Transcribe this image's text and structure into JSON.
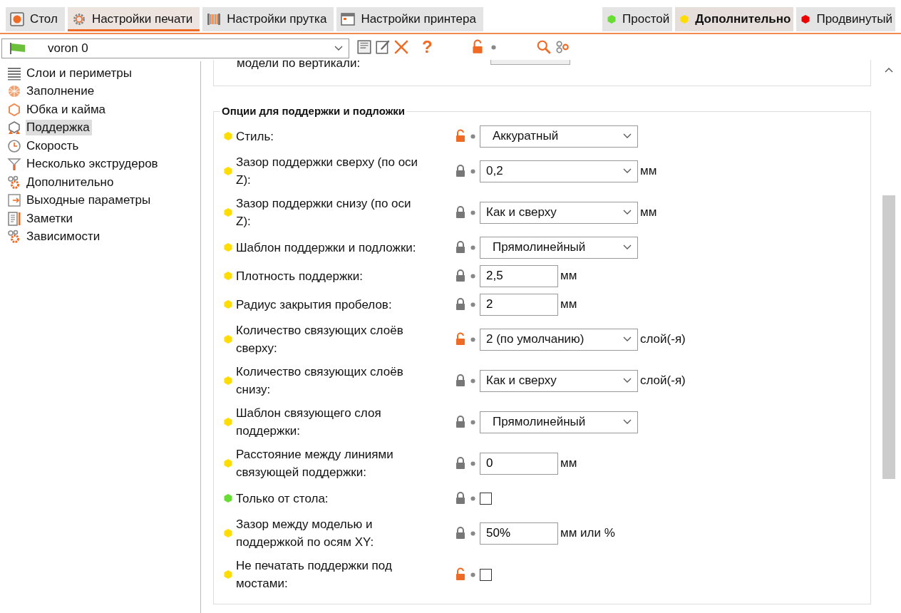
{
  "tabs": [
    {
      "label": "Стол",
      "selected": false
    },
    {
      "label": "Настройки печати",
      "selected": true
    },
    {
      "label": "Настройки прутка",
      "selected": false
    },
    {
      "label": "Настройки принтера",
      "selected": false
    }
  ],
  "modes": [
    {
      "label": "Простой",
      "color": "#66dd33",
      "selected": false
    },
    {
      "label": "Дополнительно",
      "color": "#ffdd00",
      "selected": true
    },
    {
      "label": "Продвинутый",
      "color": "#ee0000",
      "selected": false
    }
  ],
  "preset": {
    "value": "voron 0"
  },
  "toolbar": {
    "help": "?",
    "locked": false
  },
  "sidebar": {
    "items": [
      {
        "label": "Слои и периметры",
        "selected": false
      },
      {
        "label": "Заполнение",
        "selected": false
      },
      {
        "label": "Юбка и кайма",
        "selected": false
      },
      {
        "label": "Поддержка",
        "selected": true
      },
      {
        "label": "Скорость",
        "selected": false
      },
      {
        "label": "Несколько экструдеров",
        "selected": false
      },
      {
        "label": "Дополнительно",
        "selected": false
      },
      {
        "label": "Выходные параметры",
        "selected": false
      },
      {
        "label": "Заметки",
        "selected": false
      },
      {
        "label": "Зависимости",
        "selected": false
      }
    ]
  },
  "prev_section": {
    "label": "модели по вертикали:"
  },
  "section": {
    "title": "Опции для поддержки и подложки",
    "rows": [
      {
        "label": "Стиль:",
        "color": "#ffdd00",
        "locked": false,
        "kind": "combo",
        "value": "Аккуратный",
        "indent": true
      },
      {
        "label": "Зазор поддержки сверху (по оси Z):",
        "color": "#ffdd00",
        "locked": true,
        "kind": "combo",
        "value": "0,2",
        "unit": "мм",
        "indent": false
      },
      {
        "label": "Зазор поддержки снизу (по оси Z):",
        "color": "#ffdd00",
        "locked": true,
        "kind": "combo",
        "value": "Как и сверху",
        "unit": "мм",
        "indent": false
      },
      {
        "label": "Шаблон поддержки и подложки:",
        "color": "#ffdd00",
        "locked": true,
        "kind": "combo",
        "value": "Прямолинейный",
        "indent": true
      },
      {
        "label": "Плотность поддержки:",
        "color": "#ffdd00",
        "locked": true,
        "kind": "input",
        "value": "2,5",
        "unit": "мм"
      },
      {
        "label": "Радиус закрытия пробелов:",
        "color": "#ffdd00",
        "locked": true,
        "kind": "input",
        "value": "2",
        "unit": "мм"
      },
      {
        "label": "Количество связующих слоёв сверху:",
        "color": "#ffdd00",
        "locked": false,
        "kind": "combo",
        "value": "2 (по умолчанию)",
        "unit": "слой(-я)",
        "indent": false
      },
      {
        "label": "Количество связующих слоёв снизу:",
        "color": "#ffdd00",
        "locked": true,
        "kind": "combo",
        "value": "Как и сверху",
        "unit": "слой(-я)",
        "indent": false
      },
      {
        "label": "Шаблон связующего слоя поддержки:",
        "color": "#ffdd00",
        "locked": true,
        "kind": "combo",
        "value": "Прямолинейный",
        "indent": true
      },
      {
        "label": "Расстояние между линиями связующей поддержки:",
        "color": "#ffdd00",
        "locked": true,
        "kind": "input",
        "value": "0",
        "unit": "мм"
      },
      {
        "label": "Только от стола:",
        "color": "#66dd33",
        "locked": true,
        "kind": "checkbox",
        "checked": false
      },
      {
        "label": "Зазор между моделью и поддержкой по осям XY:",
        "color": "#ffdd00",
        "locked": true,
        "kind": "input",
        "value": "50%",
        "unit": "мм или %"
      },
      {
        "label": "Не печатать поддержки под мостами:",
        "color": "#ffdd00",
        "locked": false,
        "kind": "checkbox",
        "checked": false
      }
    ]
  }
}
